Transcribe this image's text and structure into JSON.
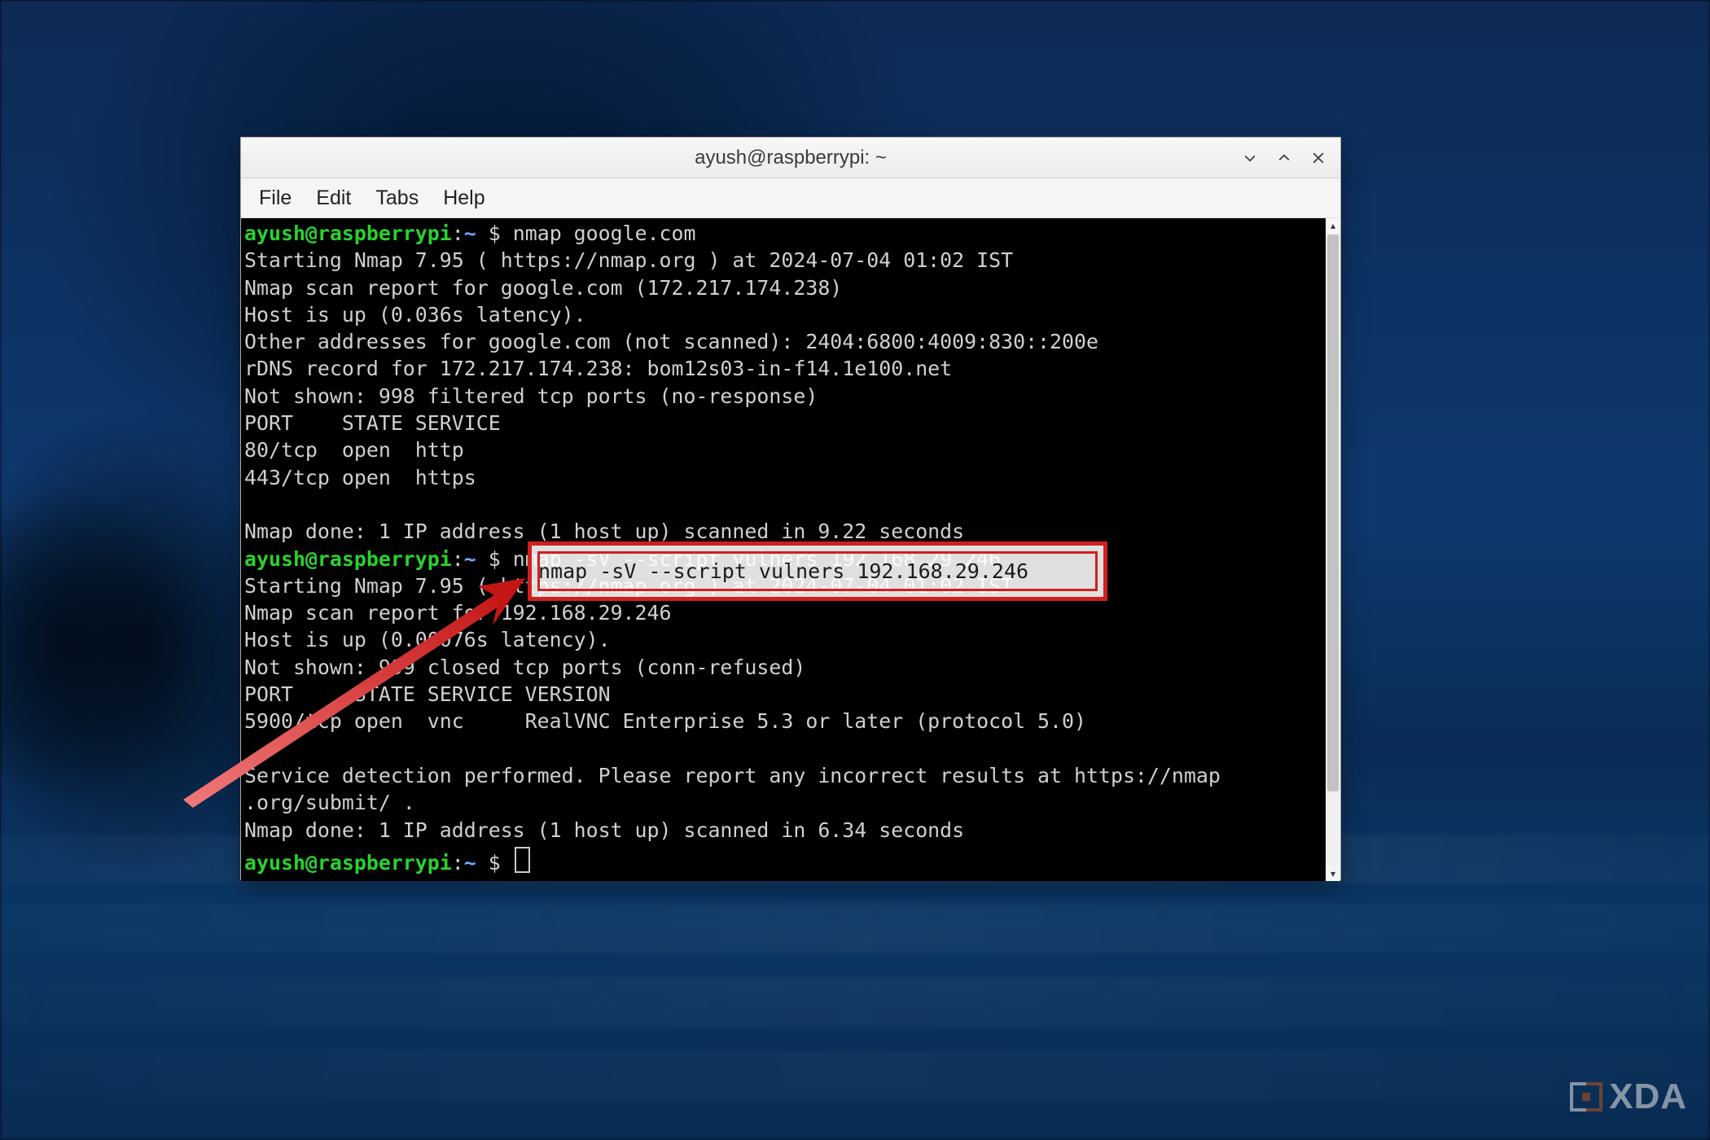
{
  "window": {
    "title": "ayush@raspberrypi: ~"
  },
  "menu": {
    "file": "File",
    "edit": "Edit",
    "tabs": "Tabs",
    "help": "Help"
  },
  "prompt": {
    "user_host": "ayush@raspberrypi",
    "sep": ":",
    "path": "~",
    "dollar": " $ "
  },
  "session": {
    "cmd1": "nmap google.com",
    "out1_1": "Starting Nmap 7.95 ( https://nmap.org ) at 2024-07-04 01:02 IST",
    "out1_2": "Nmap scan report for google.com (172.217.174.238)",
    "out1_3": "Host is up (0.036s latency).",
    "out1_4": "Other addresses for google.com (not scanned): 2404:6800:4009:830::200e",
    "out1_5": "rDNS record for 172.217.174.238: bom12s03-in-f14.1e100.net",
    "out1_6": "Not shown: 998 filtered tcp ports (no-response)",
    "out1_7": "PORT    STATE SERVICE",
    "out1_8": "80/tcp  open  http",
    "out1_9": "443/tcp open  https",
    "out1_10": "",
    "out1_11": "Nmap done: 1 IP address (1 host up) scanned in 9.22 seconds",
    "cmd2": "nmap -sV --script vulners 192.168.29.246",
    "out2_1": "Starting Nmap 7.95 ( https://nmap.org ) at 2024-07-04 01:02 IST",
    "out2_2": "Nmap scan report for 192.168.29.246",
    "out2_3": "Host is up (0.00076s latency).",
    "out2_4": "Not shown: 999 closed tcp ports (conn-refused)",
    "out2_5": "PORT     STATE SERVICE VERSION",
    "out2_6": "5900/tcp open  vnc     RealVNC Enterprise 5.3 or later (protocol 5.0)",
    "out2_7": "",
    "out2_8": "Service detection performed. Please report any incorrect results at https://nmap",
    "out2_9": ".org/submit/ .",
    "out2_10": "Nmap done: 1 IP address (1 host up) scanned in 6.34 seconds"
  },
  "annotation": {
    "highlighted_command": "nmap -sV --script vulners 192.168.29.246"
  },
  "watermark": {
    "text": "XDA"
  }
}
